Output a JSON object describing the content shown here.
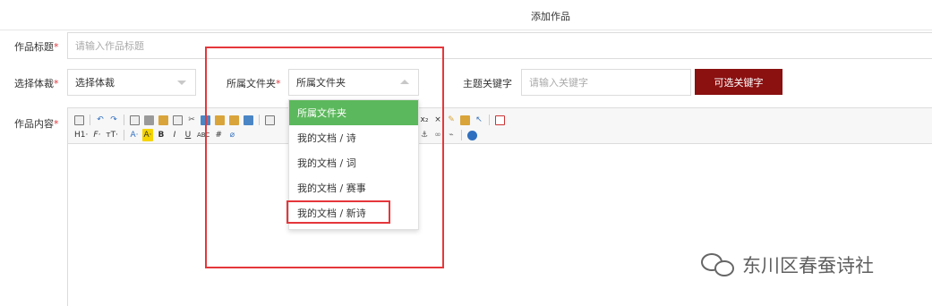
{
  "page_title": "添加作品",
  "form": {
    "title_label": "作品标题",
    "title_placeholder": "请输入作品标题",
    "genre_label": "选择体裁",
    "genre_value": "选择体裁",
    "folder_label": "所属文件夹",
    "folder_value": "所属文件夹",
    "keyword_label": "主题关键字",
    "keyword_placeholder": "请输入关键字",
    "keyword_button": "可选关键字",
    "content_label": "作品内容",
    "required_mark": "*"
  },
  "folder_dropdown": {
    "options": [
      "所属文件夹",
      "我的文档 / 诗",
      "我的文档 / 词",
      "我的文档 / 赛事",
      "我的文档 / 新诗"
    ],
    "highlighted_index": 0,
    "annotated_index": 4
  },
  "toolbar": {
    "row2": [
      "H1·",
      "F·",
      "тT·",
      "A·",
      "A·",
      "B",
      "I",
      "U",
      "ABC"
    ]
  },
  "watermark": {
    "text": "东川区春蚕诗社"
  },
  "colors": {
    "accent_red": "#8b1010",
    "highlight_green": "#5cb85c",
    "annotation_red": "#e5373b",
    "required_red": "#e0353b"
  }
}
